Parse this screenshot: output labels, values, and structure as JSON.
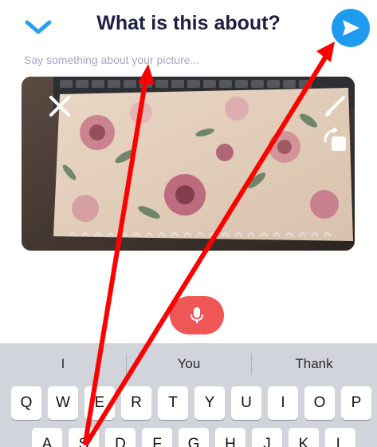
{
  "header": {
    "title": "What is this about?",
    "back_icon": "chevron-down-icon",
    "send_icon": "send-icon"
  },
  "caption": {
    "placeholder": "Say something about your picture..."
  },
  "photo_tools": {
    "close_icon": "close-icon",
    "brush_icon": "brush-icon",
    "rotate_icon": "rotate-icon"
  },
  "mic_icon": "microphone-icon",
  "keyboard": {
    "suggestions": [
      "I",
      "You",
      "Thank"
    ],
    "row1": [
      "Q",
      "W",
      "E",
      "R",
      "T",
      "Y",
      "U",
      "I",
      "O",
      "P"
    ],
    "row2": [
      "A",
      "S",
      "D",
      "F",
      "G",
      "H",
      "J",
      "K",
      "L"
    ]
  },
  "colors": {
    "title": "#1f1f44",
    "accent": "#1e9bef",
    "chevron": "#2aa0e8",
    "placeholder": "#a7a3c6",
    "mic": "#ef5656",
    "annotation_arrow": "#ff0000",
    "keyboard_bg": "#d1d4da"
  }
}
